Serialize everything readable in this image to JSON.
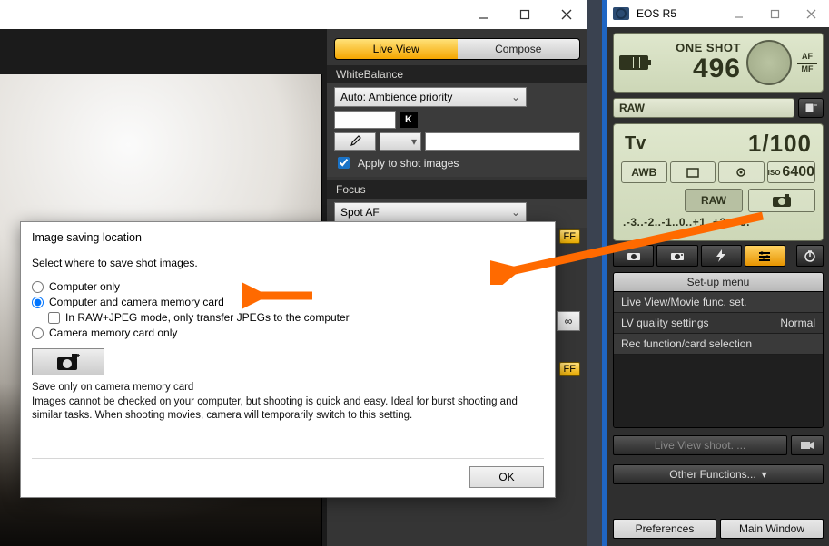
{
  "left": {
    "tabs": {
      "live": "Live View",
      "compose": "Compose"
    },
    "wb": {
      "title": "WhiteBalance",
      "mode": "Auto: Ambience priority",
      "k": "K",
      "apply": "Apply to shot images"
    },
    "focus": {
      "title": "Focus",
      "mode": "Spot AF",
      "off1": "FF",
      "infinity": "∞",
      "off2": "FF"
    }
  },
  "right": {
    "title": "EOS R5",
    "lcd_top": {
      "mode": "ONE SHOT",
      "count": "496",
      "af": "AF",
      "mf": "MF"
    },
    "raw": "RAW",
    "lcd_big": {
      "tv": "Tv",
      "speed": "1/100",
      "awb": "AWB",
      "iso_label": "ISO",
      "iso": "6400",
      "raw": "RAW",
      "scale": ".-3..-2..-1..0..+1..+2..+3."
    },
    "setup": {
      "title": "Set-up menu",
      "rows": [
        {
          "label": "Live View/Movie func. set.",
          "value": ""
        },
        {
          "label": "LV quality settings",
          "value": "Normal"
        },
        {
          "label": "Rec function/card selection",
          "value": ""
        }
      ]
    },
    "btns": {
      "liveview": "Live View shoot. ...",
      "other": "Other Functions...",
      "pref": "Preferences",
      "main": "Main Window"
    }
  },
  "dialog": {
    "title": "Image saving location",
    "sub": "Select where to save shot images.",
    "opt1": "Computer only",
    "opt2": "Computer and camera memory card",
    "chk": "In RAW+JPEG mode, only transfer JPEGs to the computer",
    "opt3": "Camera memory card only",
    "note_title": "Save only on camera memory card",
    "note_body": "Images cannot be checked on your computer, but shooting is quick and easy. Ideal for burst shooting and similar tasks. When shooting movies, camera will temporarily switch to this setting.",
    "ok": "OK"
  }
}
